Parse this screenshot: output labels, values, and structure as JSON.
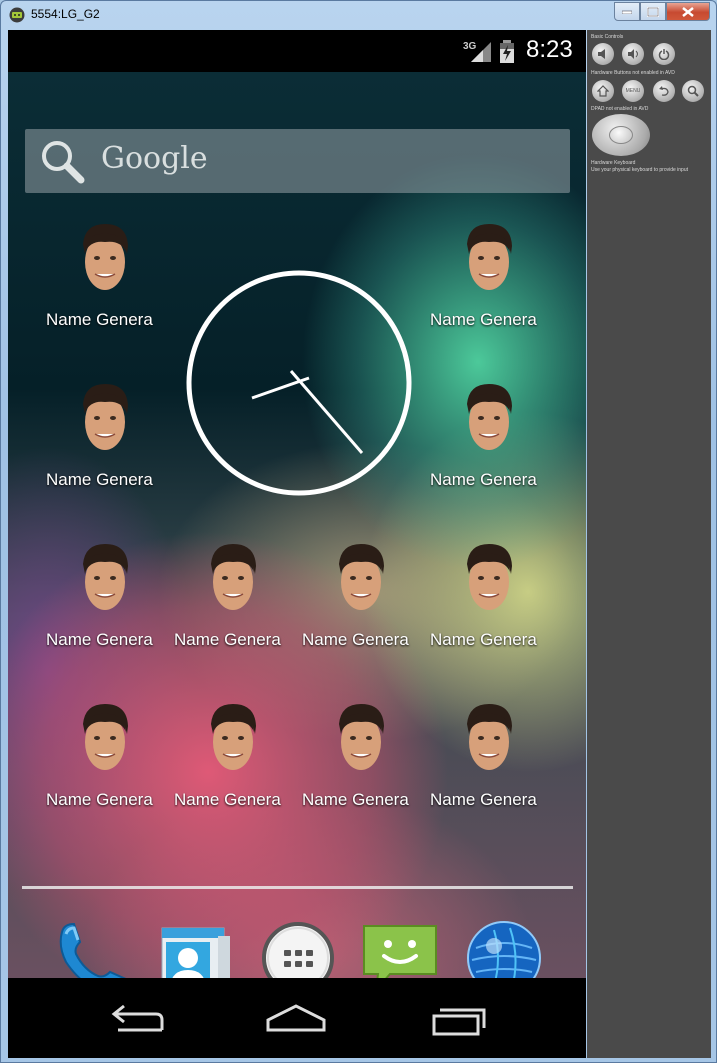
{
  "window": {
    "title": "5554:LG_G2"
  },
  "statusbar": {
    "network": "3G",
    "time": "8:23"
  },
  "search": {
    "label": "Google"
  },
  "apps": [
    {
      "label": "Name Genera"
    },
    {
      "label": "Name Genera"
    },
    {
      "label": "Name Genera"
    },
    {
      "label": "Name Genera"
    },
    {
      "label": "Name Genera"
    },
    {
      "label": "Name Genera"
    },
    {
      "label": "Name Genera"
    },
    {
      "label": "Name Genera"
    },
    {
      "label": "Name Genera"
    },
    {
      "label": "Name Genera"
    },
    {
      "label": "Name Genera"
    },
    {
      "label": "Name Genera"
    }
  ],
  "dock": [
    {
      "icon": "phone-icon"
    },
    {
      "icon": "contacts-icon"
    },
    {
      "icon": "app-drawer-icon"
    },
    {
      "icon": "messaging-icon"
    },
    {
      "icon": "browser-globe-icon"
    }
  ],
  "control_panel": {
    "basic_controls": "Basic Controls",
    "hardware_buttons": "Hardware Buttons",
    "hardware_buttons_note": "not enabled in AVD",
    "menu_label": "MENU",
    "dpad": "DPAD",
    "dpad_note": "not enabled in AVD",
    "keyboard": "Hardware Keyboard",
    "keyboard_note": "Use your physical keyboard to provide input"
  },
  "colors": {
    "accent_blue": "#33b5e5",
    "sms_green": "#8bc34a"
  }
}
